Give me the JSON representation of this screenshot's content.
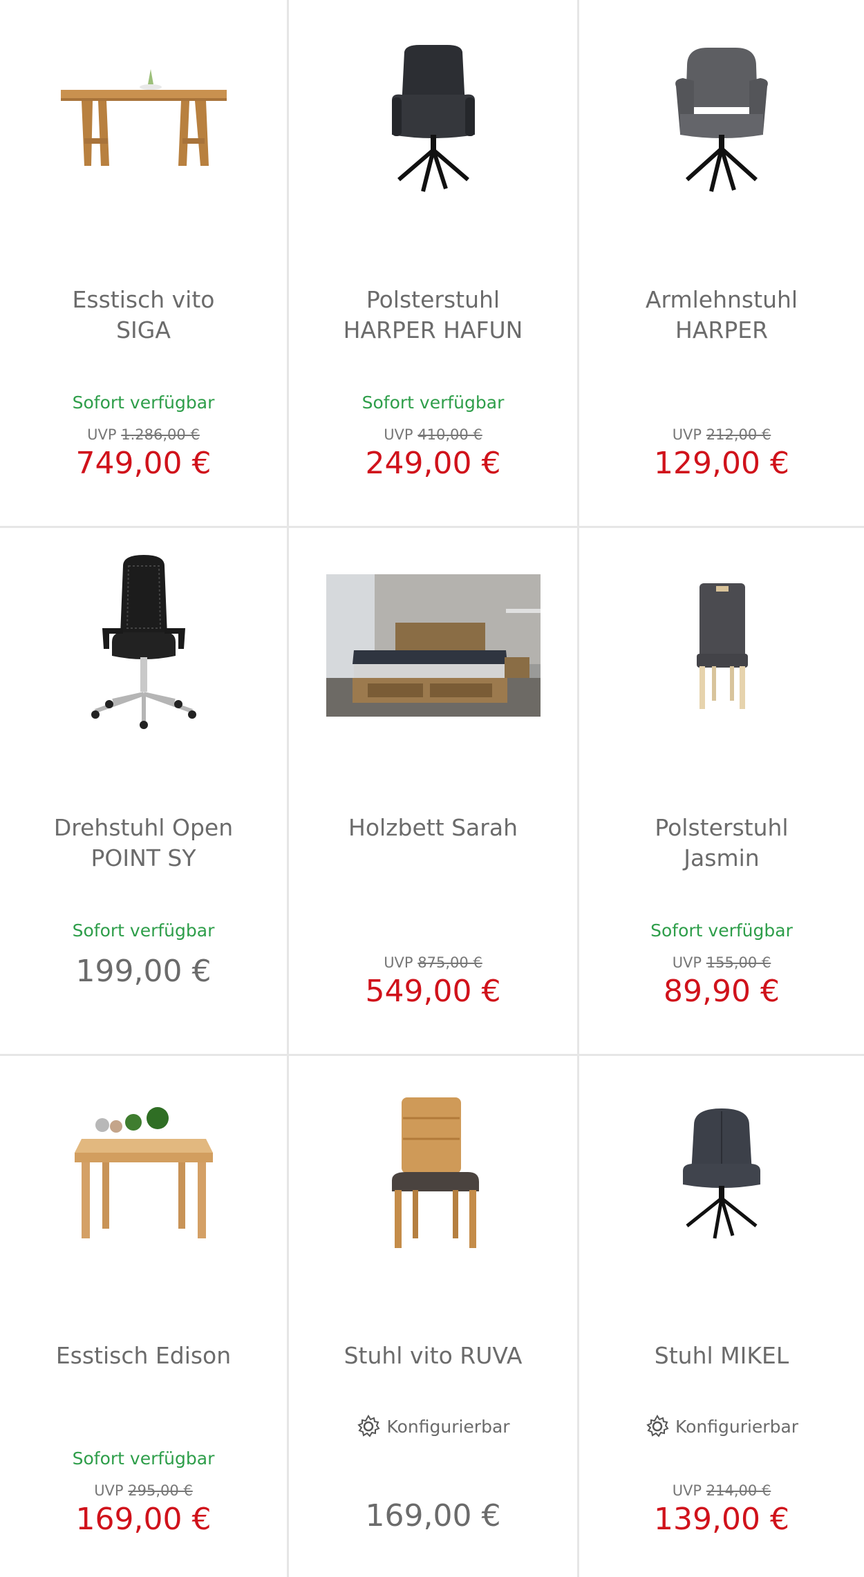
{
  "products": [
    {
      "title_1": "Esstisch vito",
      "title_2": "SIGA",
      "availability": "Sofort verfügbar",
      "uvp_label": "UVP",
      "uvp_price": "1.286,00 €",
      "price": "749,00 €"
    },
    {
      "title_1": "Polsterstuhl",
      "title_2": "HARPER HAFUN",
      "availability": "Sofort verfügbar",
      "uvp_label": "UVP",
      "uvp_price": "410,00 €",
      "price": "249,00 €"
    },
    {
      "title_1": "Armlehnstuhl",
      "title_2": "HARPER",
      "uvp_label": "UVP",
      "uvp_price": "212,00 €",
      "price": "129,00 €"
    },
    {
      "title_1": "Drehstuhl Open",
      "title_2": "POINT SY",
      "availability": "Sofort verfügbar",
      "price": "199,00 €"
    },
    {
      "title_1": "Holzbett Sarah",
      "uvp_label": "UVP",
      "uvp_price": "875,00 €",
      "price": "549,00 €"
    },
    {
      "title_1": "Polsterstuhl",
      "title_2": "Jasmin",
      "availability": "Sofort verfügbar",
      "uvp_label": "UVP",
      "uvp_price": "155,00 €",
      "price": "89,90 €"
    },
    {
      "title_1": "Esstisch Edison",
      "availability": "Sofort verfügbar",
      "uvp_label": "UVP",
      "uvp_price": "295,00 €",
      "price": "169,00 €"
    },
    {
      "title_1": "Stuhl vito RUVA",
      "config": "Konfigurierbar",
      "price": "169,00 €"
    },
    {
      "title_1": "Stuhl MIKEL",
      "config": "Konfigurierbar",
      "uvp_label": "UVP",
      "uvp_price": "214,00 €",
      "price": "139,00 €"
    }
  ],
  "colors": {
    "sale": "#d0121b",
    "available": "#2e9e4a",
    "text": "#6b6b6b",
    "divider": "#e6e6e6"
  },
  "icons": {
    "config": "gear-icon"
  }
}
